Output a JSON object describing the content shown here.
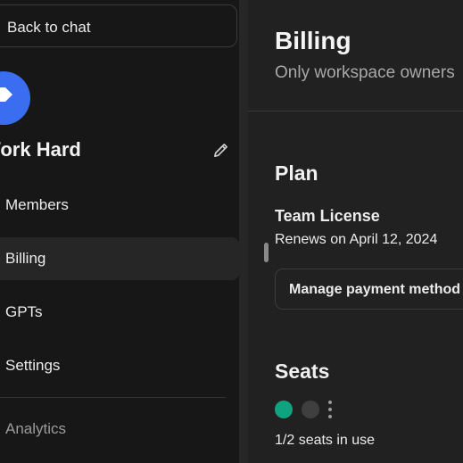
{
  "sidebar": {
    "back_label": "Back to chat",
    "workspace_name": "Work Hard",
    "items": [
      {
        "label": "Members"
      },
      {
        "label": "Billing"
      },
      {
        "label": "GPTs"
      },
      {
        "label": "Settings"
      },
      {
        "label": "Analytics"
      }
    ]
  },
  "main": {
    "title": "Billing",
    "subtitle": "Only workspace owners",
    "plan": {
      "heading": "Plan",
      "name": "Team License",
      "renewal": "Renews on April 12, 2024",
      "manage_label": "Manage payment method"
    },
    "seats": {
      "heading": "Seats",
      "usage": "1/2 seats in use",
      "used_fraction": 0.5
    }
  },
  "colors": {
    "accent_avatar": "#3b6df0",
    "seat_used": "#10a37f",
    "seat_free": "#3f3f3f"
  },
  "icons": [
    "tag-icon",
    "pencil-icon",
    "more-vertical-icon"
  ]
}
